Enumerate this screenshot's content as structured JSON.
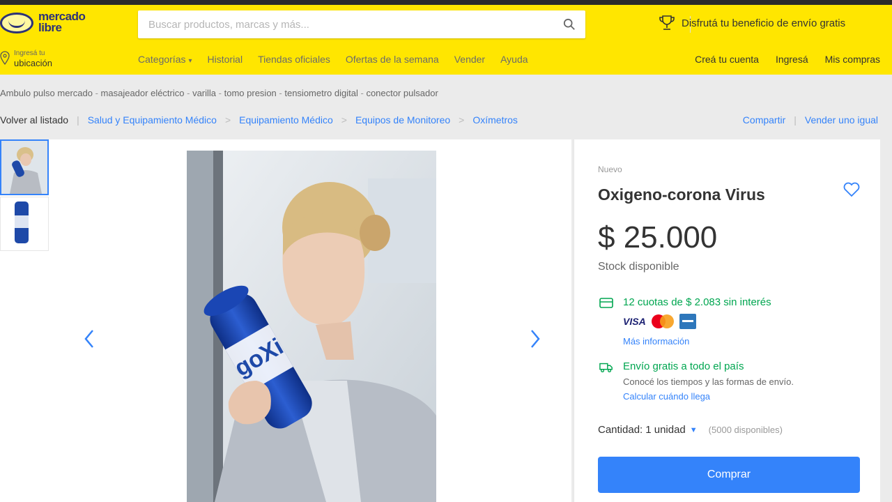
{
  "header": {
    "logo_text_line1": "mercado",
    "logo_text_line2": "libre",
    "search_placeholder": "Buscar productos, marcas y más...",
    "promo_text": "Disfrutá tu beneficio de envío gratis",
    "location_label": "Ingresá tu",
    "location_value": "ubicación",
    "nav": [
      {
        "label": "Categorías"
      },
      {
        "label": "Historial"
      },
      {
        "label": "Tiendas oficiales"
      },
      {
        "label": "Ofertas de la semana"
      },
      {
        "label": "Vender"
      },
      {
        "label": "Ayuda"
      }
    ],
    "account": [
      {
        "label": "Creá tu cuenta"
      },
      {
        "label": "Ingresá"
      },
      {
        "label": "Mis compras"
      }
    ]
  },
  "related_searches": [
    "Ambulo pulso mercado",
    "masajeador eléctrico",
    "varilla",
    "tomo presion",
    "tensiometro digital",
    "conector pulsador"
  ],
  "breadcrumb": {
    "back": "Volver al listado",
    "items": [
      "Salud y Equipamiento Médico",
      "Equipamiento Médico",
      "Equipos de Monitoreo",
      "Oxímetros"
    ],
    "share": "Compartir",
    "sell": "Vender uno igual"
  },
  "product": {
    "condition": "Nuevo",
    "title": "Oxigeno-corona Virus",
    "price": "$ 25.000",
    "stock": "Stock disponible",
    "installments": "12 cuotas de $ 2.083 sin interés",
    "payment_cards": [
      "VISA",
      "mastercard",
      "amex"
    ],
    "more_info": "Más información",
    "shipping_title": "Envío gratis a todo el país",
    "shipping_sub": "Conocé los tiempos y las formas de envío.",
    "shipping_link": "Calcular cuándo llega",
    "quantity_label": "Cantidad:",
    "quantity_value": "1 unidad",
    "quantity_available": "(5000 disponibles)",
    "buy_button": "Comprar",
    "can_label": "goXi"
  },
  "colors": {
    "header_yellow": "#ffe600",
    "link_blue": "#3483fa",
    "green": "#00a650",
    "button_blue": "#3483fa"
  }
}
